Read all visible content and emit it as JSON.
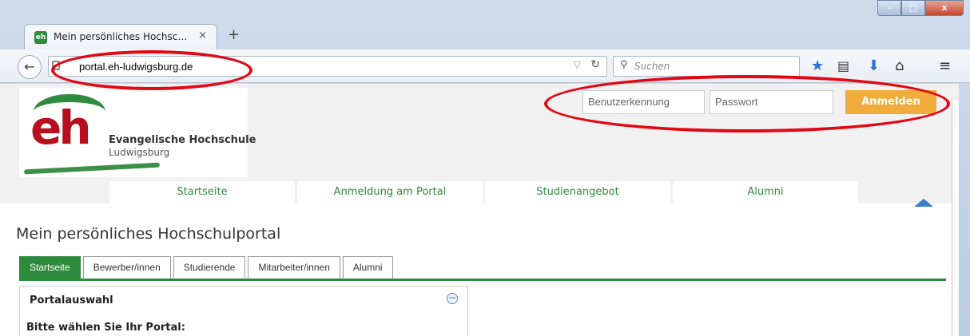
{
  "browser": {
    "tab_title": "Mein persönliches Hochsc…",
    "tab_close": "×",
    "new_tab": "+",
    "favicon_text": "eh",
    "url": "portal.eh-ludwigsburg.de",
    "search_placeholder": "Suchen",
    "window_min": "–",
    "window_max": "□",
    "window_close": "x"
  },
  "header": {
    "logo_mark": "eh",
    "logo_name_line1": "Evangelische Hochschule",
    "logo_name_line2": "Ludwigsburg",
    "login_user_placeholder": "Benutzerkennung",
    "login_pass_placeholder": "Passwort",
    "login_button": "Anmelden"
  },
  "main_nav": [
    {
      "label": "Startseite"
    },
    {
      "label": "Anmeldung am Portal"
    },
    {
      "label": "Studienangebot"
    },
    {
      "label": "Alumni"
    }
  ],
  "page_title": "Mein persönliches Hochschulportal",
  "tabs": [
    {
      "label": "Startseite",
      "active": true
    },
    {
      "label": "Bewerber/innen"
    },
    {
      "label": "Studierende"
    },
    {
      "label": "Mitarbeiter/innen"
    },
    {
      "label": "Alumni"
    }
  ],
  "portlet": {
    "title": "Portalauswahl",
    "subtitle": "Bitte wählen Sie Ihr Portal:",
    "collapse_symbol": "−"
  },
  "colors": {
    "brand_green": "#2e8b3d",
    "brand_red": "#b80f1e",
    "login_orange": "#f0ad3b",
    "annotation_red": "#e30613"
  }
}
